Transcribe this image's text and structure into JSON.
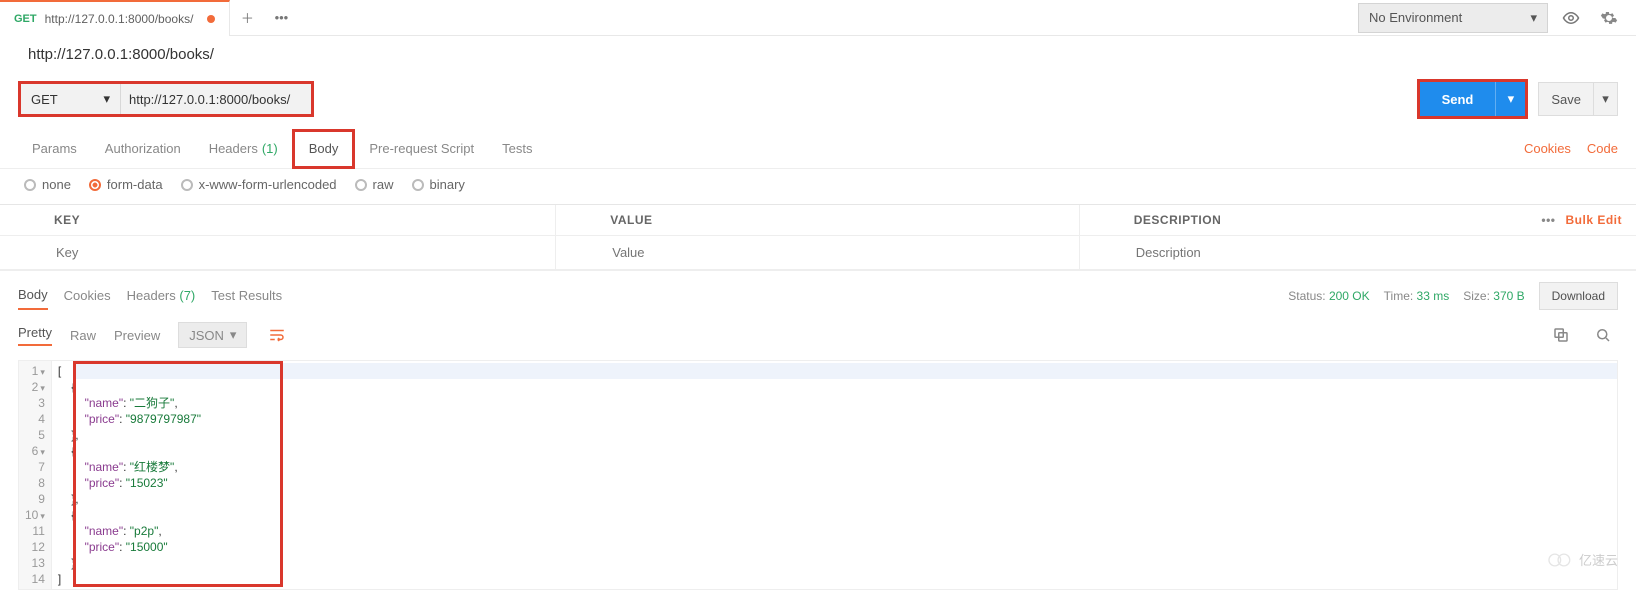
{
  "topbar": {
    "env": "No Environment",
    "tab_method": "GET",
    "tab_url": "http://127.0.0.1:8000/books/"
  },
  "request": {
    "title": "http://127.0.0.1:8000/books/",
    "method": "GET",
    "url": "http://127.0.0.1:8000/books/",
    "send_label": "Send",
    "save_label": "Save",
    "tabs": {
      "params": "Params",
      "auth": "Authorization",
      "headers": "Headers",
      "headers_count": "(1)",
      "body": "Body",
      "prerequest": "Pre-request Script",
      "tests": "Tests"
    },
    "cookies_link": "Cookies",
    "code_link": "Code",
    "body_types": {
      "none": "none",
      "formdata": "form-data",
      "xform": "x-www-form-urlencoded",
      "raw": "raw",
      "binary": "binary"
    },
    "kv": {
      "key_h": "KEY",
      "value_h": "VALUE",
      "desc_h": "DESCRIPTION",
      "bulk": "Bulk Edit",
      "key_ph": "Key",
      "value_ph": "Value",
      "desc_ph": "Description"
    }
  },
  "response": {
    "tabs": {
      "body": "Body",
      "cookies": "Cookies",
      "headers": "Headers",
      "headers_count": "(7)",
      "tests": "Test Results"
    },
    "status_label": "Status:",
    "status_value": "200 OK",
    "time_label": "Time:",
    "time_value": "33 ms",
    "size_label": "Size:",
    "size_value": "370 B",
    "download": "Download",
    "viewer": {
      "pretty": "Pretty",
      "raw": "Raw",
      "preview": "Preview",
      "lang": "JSON"
    },
    "body_data": [
      {
        "name": "二狗子",
        "price": "9879797987"
      },
      {
        "name": "红楼梦",
        "price": "15023"
      },
      {
        "name": "p2p",
        "price": "15000"
      }
    ]
  },
  "watermark": "亿速云"
}
